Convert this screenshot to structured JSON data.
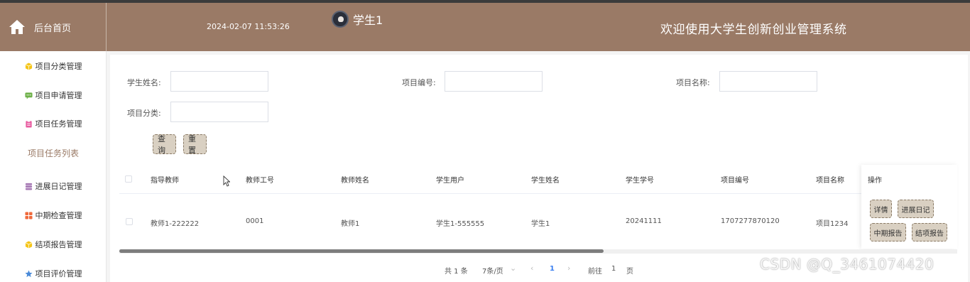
{
  "header": {
    "home_label": "后台首页",
    "datetime": "2024-02-07 11:53:26",
    "username": "学生1",
    "welcome": "欢迎使用大学生创新创业管理系统",
    "bg_color": "#9a7a66"
  },
  "sidebar": {
    "items": [
      {
        "label": "项目分类管理",
        "icon": "cube-icon",
        "color": "#f5c518"
      },
      {
        "label": "项目申请管理",
        "icon": "chat-icon",
        "color": "#6fb14a"
      },
      {
        "label": "项目任务管理",
        "icon": "clipboard-icon",
        "color": "#e85ca0"
      },
      {
        "label": "进展日记管理",
        "icon": "database-icon",
        "color": "#a77ab5"
      },
      {
        "label": "中期检查管理",
        "icon": "grid-icon",
        "color": "#ef6a3c"
      },
      {
        "label": "结项报告管理",
        "icon": "cube-icon",
        "color": "#f5c518"
      },
      {
        "label": "项目评价管理",
        "icon": "star-icon",
        "color": "#4a8ad8"
      }
    ],
    "active_subitem": "项目任务列表"
  },
  "search": {
    "student_name_label": "学生姓名:",
    "project_no_label": "项目编号:",
    "project_name_label": "项目名称:",
    "project_category_label": "项目分类:",
    "query_button": "查询",
    "reset_button": "重置"
  },
  "table": {
    "columns": [
      "指导教师",
      "教师工号",
      "教师姓名",
      "学生用户",
      "学生姓名",
      "学生学号",
      "项目编号",
      "项目名称"
    ],
    "rows": [
      [
        "教师1-222222",
        "0001",
        "教师1",
        "学生1-555555",
        "学生1",
        "20241111",
        "1707277870120",
        "项目1234"
      ]
    ],
    "ops_header": "操作",
    "ops": [
      "详情",
      "进展日记",
      "中期报告",
      "结项报告"
    ]
  },
  "pagination": {
    "total": "共 1 条",
    "page_size": "7条/页",
    "current": "1",
    "goto_label": "前往",
    "goto_value": "1",
    "page_suffix": "页"
  },
  "watermark": "CSDN @Q_3461074420"
}
